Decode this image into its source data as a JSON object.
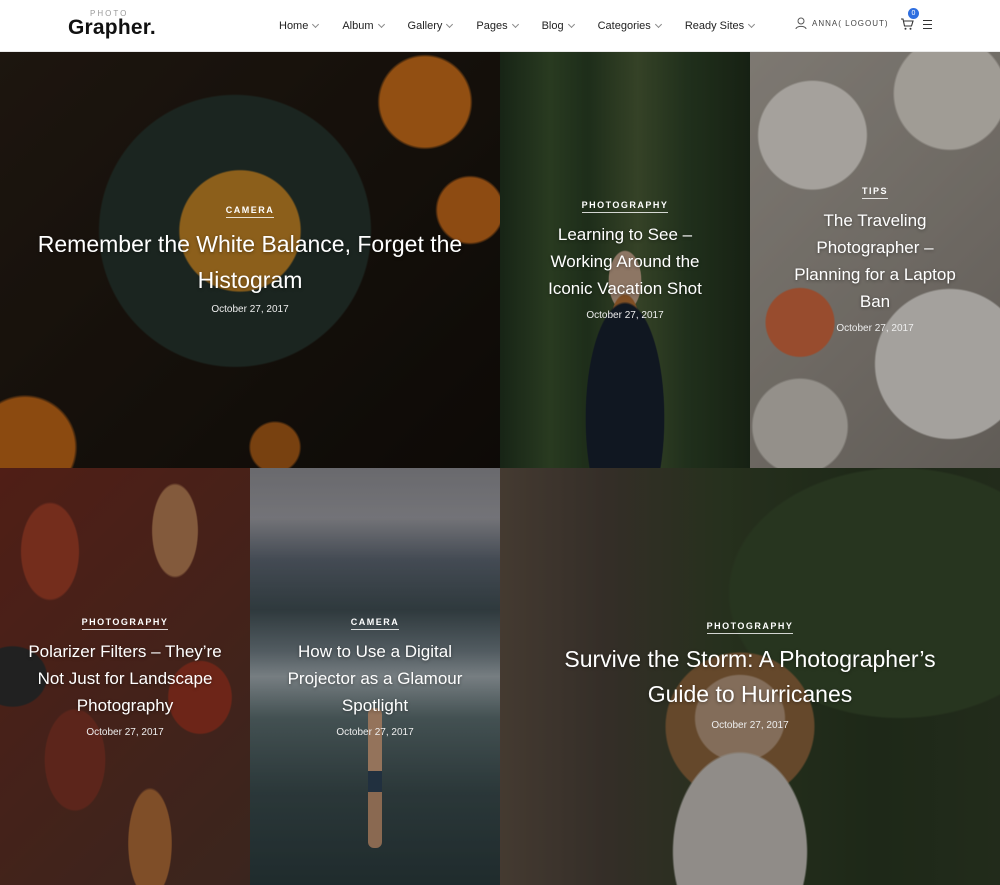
{
  "header": {
    "logo_small": "PHOTO",
    "logo_main": "Grapher.",
    "nav": [
      {
        "label": "Home"
      },
      {
        "label": "Album"
      },
      {
        "label": "Gallery"
      },
      {
        "label": "Pages"
      },
      {
        "label": "Blog"
      },
      {
        "label": "Categories"
      },
      {
        "label": "Ready Sites"
      }
    ],
    "user_label": "ANNA( LOGOUT)",
    "cart_count": "0",
    "accent_color": "#2f6fe0"
  },
  "posts": [
    {
      "category": "CAMERA",
      "title": "Remember the White Balance, Forget the Histogram",
      "date": "October 27, 2017"
    },
    {
      "category": "PHOTOGRAPHY",
      "title": "Learning to See – Working Around the Iconic Vacation Shot",
      "date": "October 27, 2017"
    },
    {
      "category": "TIPS",
      "title": "The Traveling Photographer – Planning for a Laptop Ban",
      "date": "October 27, 2017"
    },
    {
      "category": "PHOTOGRAPHY",
      "title": "Polarizer Filters – They’re Not Just for Landscape Photography",
      "date": "October 27, 2017"
    },
    {
      "category": "CAMERA",
      "title": "How to Use a Digital Projector as a Glamour Spotlight",
      "date": "October 27, 2017"
    },
    {
      "category": "PHOTOGRAPHY",
      "title": "Survive the Storm: A Photographer’s Guide to Hurricanes",
      "date": "October 27, 2017"
    }
  ]
}
